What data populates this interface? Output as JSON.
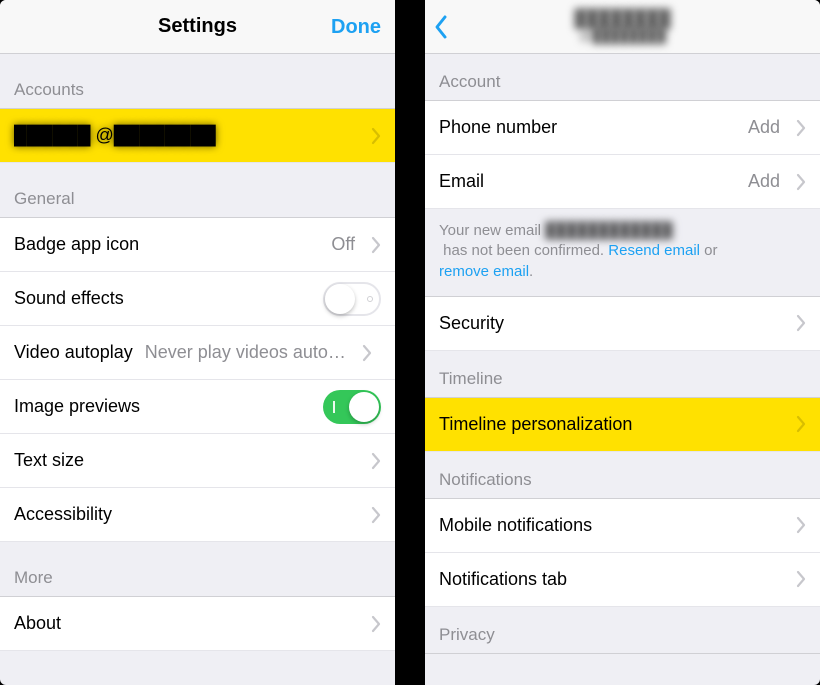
{
  "left": {
    "nav": {
      "title": "Settings",
      "done": "Done"
    },
    "sections": {
      "accounts_hdr": "Accounts",
      "account_row": "██████ @████████",
      "general_hdr": "General",
      "badge": {
        "label": "Badge app icon",
        "value": "Off"
      },
      "sound": {
        "label": "Sound effects"
      },
      "autoplay": {
        "label": "Video autoplay",
        "value": "Never play videos auto…"
      },
      "previews": {
        "label": "Image previews"
      },
      "textsize": {
        "label": "Text size"
      },
      "a11y": {
        "label": "Accessibility"
      },
      "more_hdr": "More",
      "about": {
        "label": "About"
      }
    }
  },
  "right": {
    "nav": {
      "name": "████████",
      "handle": "@████████"
    },
    "sections": {
      "account_hdr": "Account",
      "phone": {
        "label": "Phone number",
        "value": "Add"
      },
      "email": {
        "label": "Email",
        "value": "Add"
      },
      "note_a": "Your new email ",
      "note_b": "████████████",
      "note_c": " has not been confirmed. ",
      "note_resend": "Resend email",
      "note_or": " or ",
      "note_remove": "remove email",
      "note_dot": ".",
      "security": {
        "label": "Security"
      },
      "timeline_hdr": "Timeline",
      "timeline_personalization": {
        "label": "Timeline personalization"
      },
      "notifications_hdr": "Notifications",
      "mobile_notif": {
        "label": "Mobile notifications"
      },
      "notif_tab": {
        "label": "Notifications tab"
      },
      "privacy_hdr": "Privacy"
    }
  }
}
